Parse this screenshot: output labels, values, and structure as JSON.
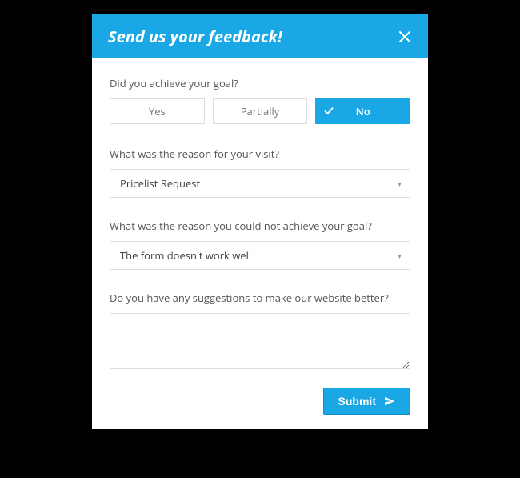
{
  "header": {
    "title": "Send us your feedback!"
  },
  "q1": {
    "label": "Did you achieve your goal?",
    "options": {
      "yes": "Yes",
      "partially": "Partially",
      "no": "No"
    },
    "selected": "no"
  },
  "q2": {
    "label": "What was the reason for your visit?",
    "value": "Pricelist Request"
  },
  "q3": {
    "label": "What was the reason you could not achieve your goal?",
    "value": "The form doesn't work well"
  },
  "q4": {
    "label": "Do you have any suggestions to make our website better?",
    "value": ""
  },
  "footer": {
    "submit_label": "Submit"
  }
}
